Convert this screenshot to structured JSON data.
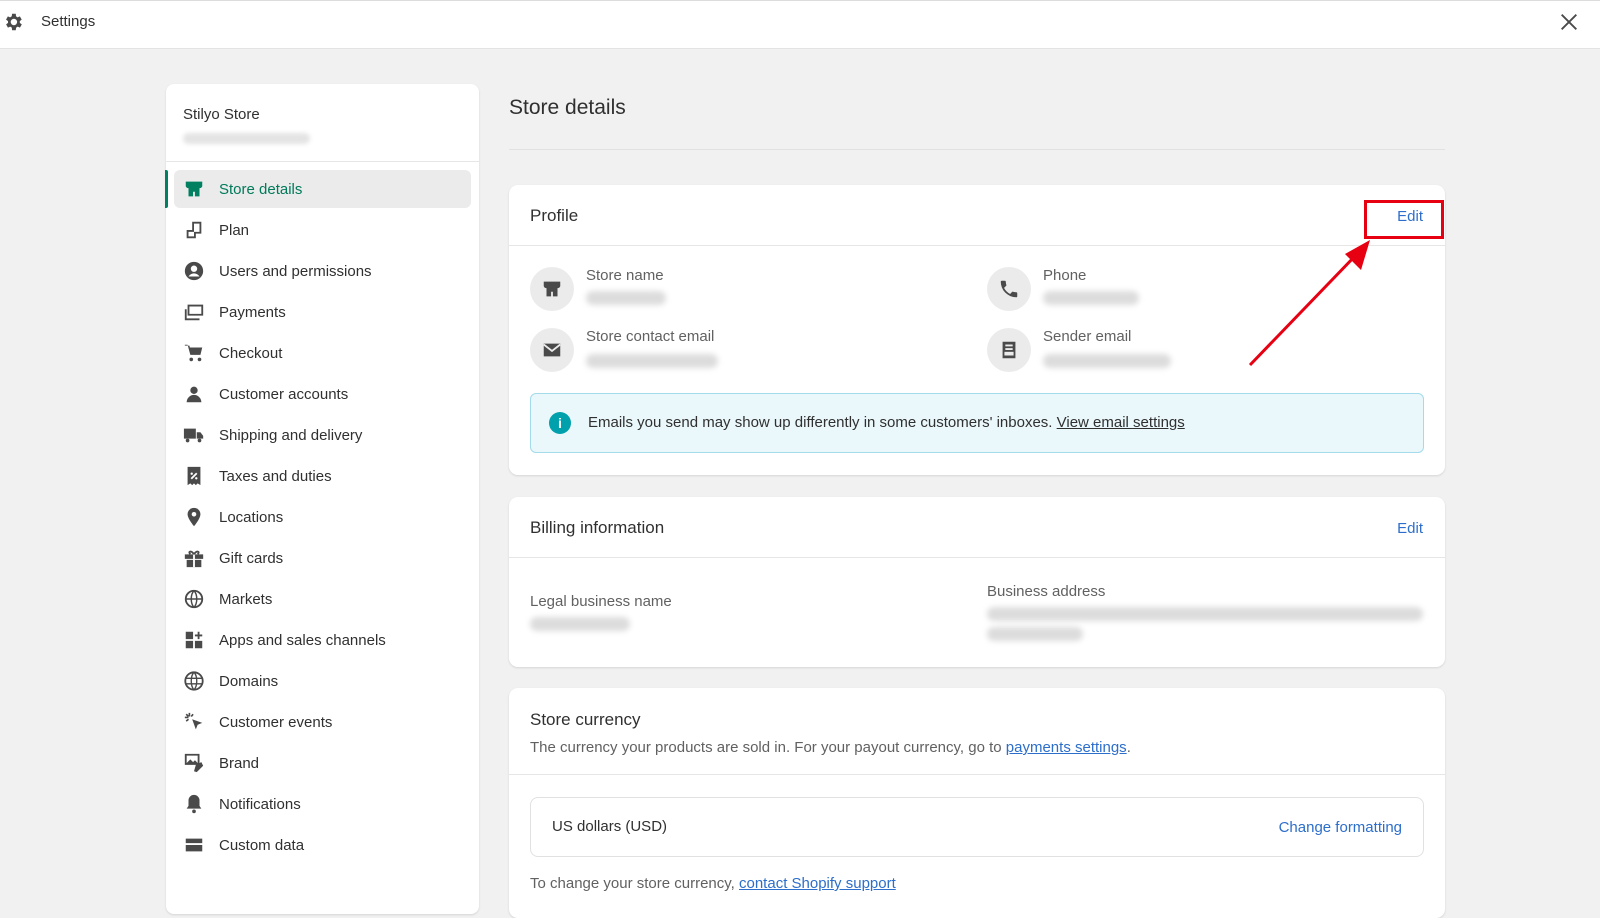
{
  "window": {
    "title": "Settings",
    "gear_icon": "gear-icon",
    "close_icon": "close-icon"
  },
  "sidebar": {
    "store_name": "Stilyo Store",
    "items": [
      {
        "label": "Store details",
        "icon": "store-icon",
        "active": true
      },
      {
        "label": "Plan",
        "icon": "plan-icon"
      },
      {
        "label": "Users and permissions",
        "icon": "user-circle-icon"
      },
      {
        "label": "Payments",
        "icon": "payments-icon"
      },
      {
        "label": "Checkout",
        "icon": "cart-icon"
      },
      {
        "label": "Customer accounts",
        "icon": "person-icon"
      },
      {
        "label": "Shipping and delivery",
        "icon": "truck-icon"
      },
      {
        "label": "Taxes and duties",
        "icon": "tax-icon"
      },
      {
        "label": "Locations",
        "icon": "location-pin-icon"
      },
      {
        "label": "Gift cards",
        "icon": "gift-icon"
      },
      {
        "label": "Markets",
        "icon": "globe-icon"
      },
      {
        "label": "Apps and sales channels",
        "icon": "apps-icon"
      },
      {
        "label": "Domains",
        "icon": "domain-globe-icon"
      },
      {
        "label": "Customer events",
        "icon": "cursor-click-icon"
      },
      {
        "label": "Brand",
        "icon": "brand-icon"
      },
      {
        "label": "Notifications",
        "icon": "bell-icon"
      },
      {
        "label": "Custom data",
        "icon": "database-icon"
      }
    ]
  },
  "main": {
    "page_title": "Store details",
    "profile": {
      "title": "Profile",
      "edit_label": "Edit",
      "store_name_label": "Store name",
      "phone_label": "Phone",
      "store_contact_email_label": "Store contact email",
      "sender_email_label": "Sender email",
      "banner_text": "Emails you send may show up differently in some customers' inboxes.",
      "banner_link": "View email settings"
    },
    "billing": {
      "title": "Billing information",
      "edit_label": "Edit",
      "legal_business_name_label": "Legal business name",
      "business_address_label": "Business address"
    },
    "currency": {
      "title": "Store currency",
      "description": "The currency your products are sold in. For your payout currency, go to",
      "description_link": "payments settings",
      "description_end": ".",
      "currency_name": "US dollars (USD)",
      "change_formatting": "Change formatting",
      "footer_text": "To change your store currency,",
      "footer_link": "contact Shopify support"
    }
  },
  "colors": {
    "accent_green": "#008060",
    "link_blue": "#2c6ecb",
    "annotation_red": "#e60012",
    "banner_bg": "#eaf7fb"
  }
}
